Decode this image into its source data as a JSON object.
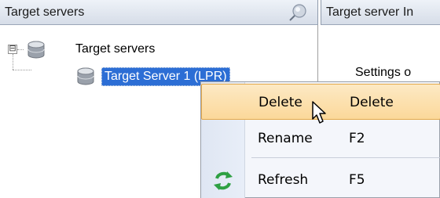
{
  "left_panel": {
    "title": "Target servers",
    "tree": {
      "root": {
        "label": "Target servers",
        "expander": "⊟",
        "icon": "database-icon"
      },
      "child": {
        "label": "Target Server 1 (LPR)",
        "icon": "database-icon"
      }
    }
  },
  "right_panel": {
    "title": "Target server In",
    "settings_text": "Settings o"
  },
  "context_menu": {
    "items": [
      {
        "label": "Delete",
        "shortcut": "Delete",
        "icon": ""
      },
      {
        "label": "Rename",
        "shortcut": "F2",
        "icon": ""
      },
      {
        "label": "Refresh",
        "shortcut": "F5",
        "icon": "refresh-icon"
      }
    ]
  },
  "colors": {
    "selection": "#2c6ed5",
    "menu_hover": "#fbd89a",
    "header_gradient_top": "#eef2f8",
    "refresh_icon": "#2ea043"
  }
}
